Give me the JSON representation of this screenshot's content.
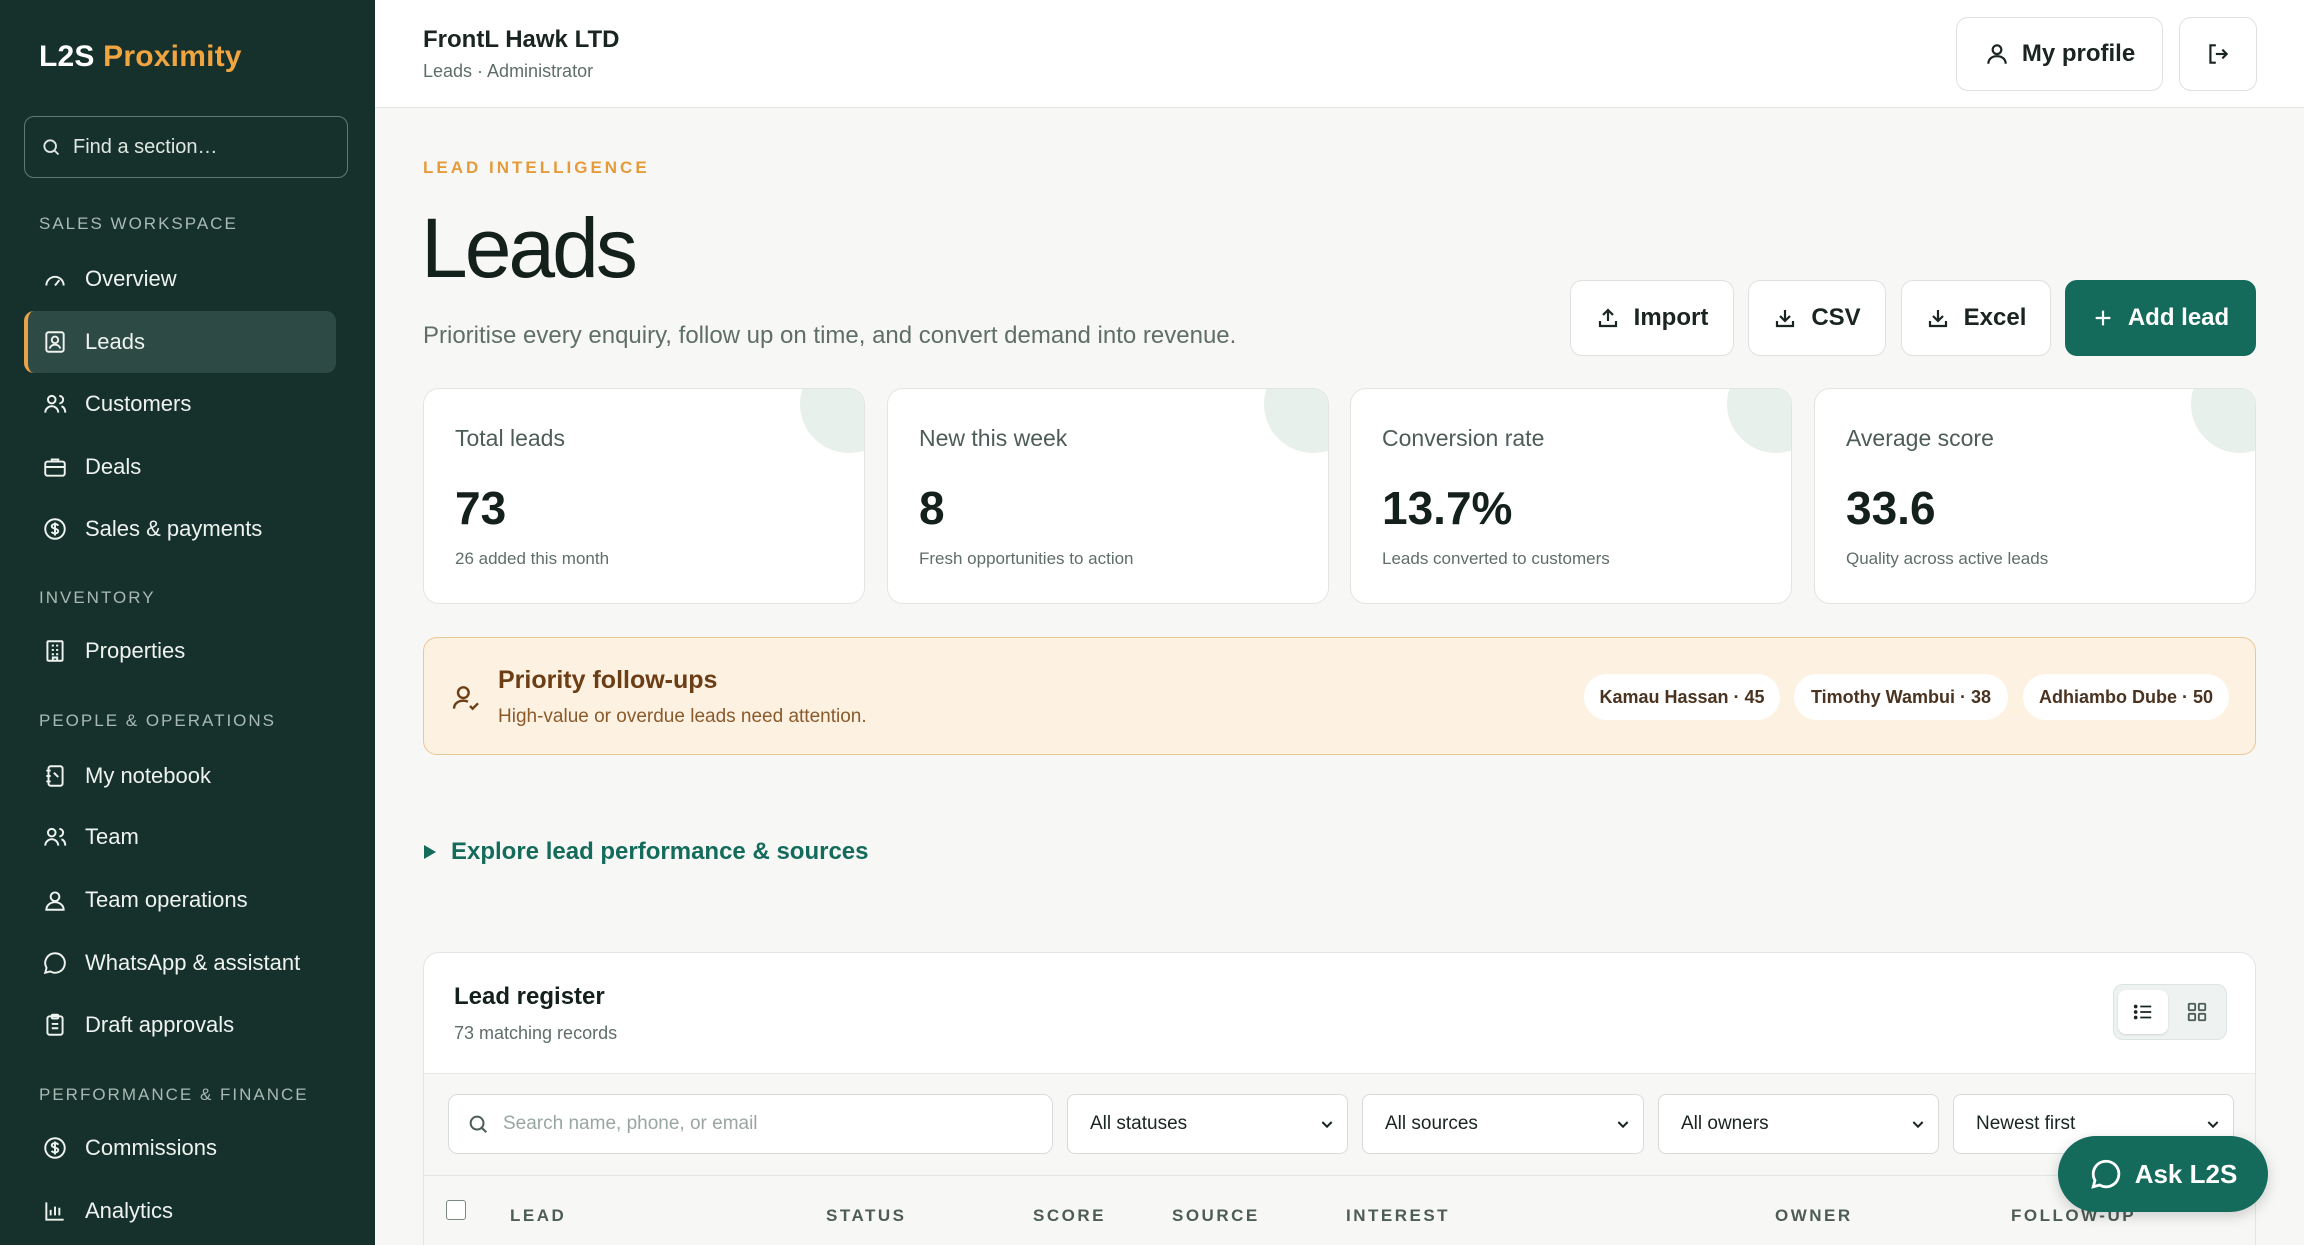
{
  "brand": {
    "part1": "L2S",
    "part2": "Proximity"
  },
  "sidebar": {
    "search_placeholder": "Find a section…",
    "sections": [
      {
        "label": "SALES WORKSPACE"
      },
      {
        "label": "INVENTORY"
      },
      {
        "label": "PEOPLE & OPERATIONS"
      },
      {
        "label": "PERFORMANCE & FINANCE"
      }
    ],
    "items": [
      {
        "label": "Overview",
        "icon": "gauge-icon"
      },
      {
        "label": "Leads",
        "icon": "contact-card-icon",
        "active": true
      },
      {
        "label": "Customers",
        "icon": "users-icon"
      },
      {
        "label": "Deals",
        "icon": "briefcase-icon"
      },
      {
        "label": "Sales & payments",
        "icon": "dollar-circle-icon"
      },
      {
        "label": "Properties",
        "icon": "building-icon"
      },
      {
        "label": "My notebook",
        "icon": "notebook-icon"
      },
      {
        "label": "Team",
        "icon": "users-icon"
      },
      {
        "label": "Team operations",
        "icon": "user-check-icon"
      },
      {
        "label": "WhatsApp & assistant",
        "icon": "chat-bubble-icon"
      },
      {
        "label": "Draft approvals",
        "icon": "clipboard-icon"
      },
      {
        "label": "Commissions",
        "icon": "dollar-circle-icon"
      },
      {
        "label": "Analytics",
        "icon": "bar-chart-icon"
      }
    ]
  },
  "header": {
    "org_name": "FrontL Hawk LTD",
    "org_sub": "Leads · Administrator",
    "profile_label": "My profile"
  },
  "page": {
    "eyebrow": "LEAD INTELLIGENCE",
    "title": "Leads",
    "subtitle": "Prioritise every enquiry, follow up on time, and convert demand into revenue."
  },
  "actions": {
    "import": "Import",
    "csv": "CSV",
    "excel": "Excel",
    "add": "Add lead"
  },
  "stats": [
    {
      "label": "Total leads",
      "value": "73",
      "note": "26 added this month"
    },
    {
      "label": "New this week",
      "value": "8",
      "note": "Fresh opportunities to action"
    },
    {
      "label": "Conversion rate",
      "value": "13.7%",
      "note": "Leads converted to customers"
    },
    {
      "label": "Average score",
      "value": "33.6",
      "note": "Quality across active leads"
    }
  ],
  "priority": {
    "title": "Priority follow-ups",
    "subtitle": "High-value or overdue leads need attention.",
    "chips": [
      "Kamau Hassan · 45",
      "Timothy Wambui · 38",
      "Adhiambo Dube · 50"
    ]
  },
  "explore": {
    "label": "Explore lead performance & sources"
  },
  "register": {
    "title": "Lead register",
    "count": "73 matching records",
    "search_placeholder": "Search name, phone, or email",
    "filters": {
      "status": "All statuses",
      "source": "All sources",
      "owner": "All owners",
      "sort": "Newest first"
    },
    "columns": [
      "LEAD",
      "STATUS",
      "SCORE",
      "SOURCE",
      "INTEREST",
      "OWNER",
      "FOLLOW-UP"
    ]
  },
  "assistant": {
    "label": "Ask L2S"
  },
  "colors": {
    "sidebar_bg": "#16302b",
    "brand_accent": "#f0a540",
    "primary": "#146b5b",
    "priority_bg": "#fdf1e1"
  }
}
